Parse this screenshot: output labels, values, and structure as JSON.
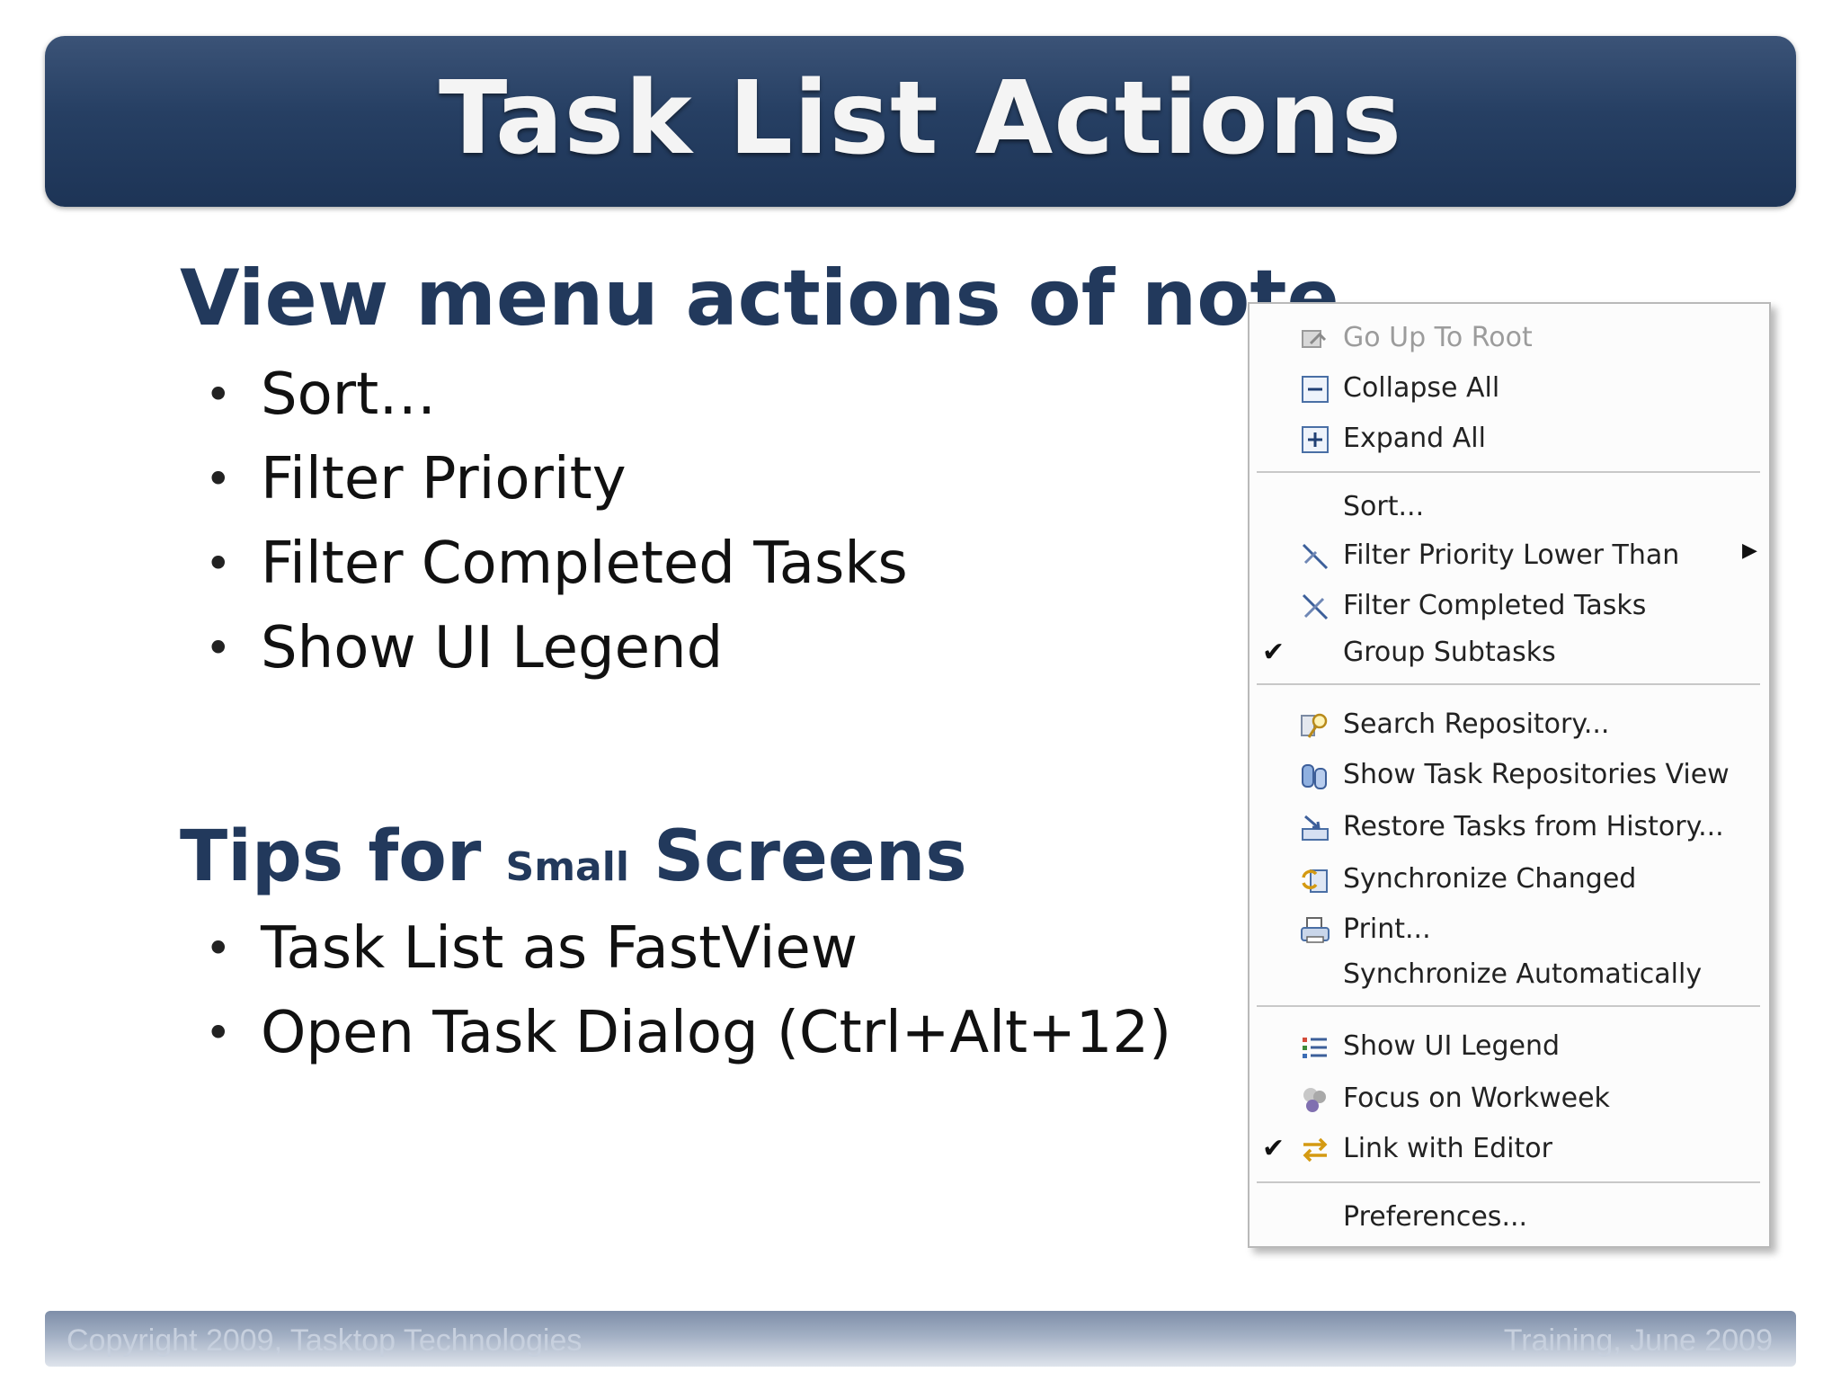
{
  "slide": {
    "title": "Task List Actions",
    "section1": {
      "heading": "View menu actions of note",
      "bullets": [
        "Sort…",
        "Filter Priority",
        "Filter Completed Tasks",
        "Show UI Legend"
      ]
    },
    "section2": {
      "heading_part1": "Tips for ",
      "heading_small": "Small",
      "heading_part2": " Screens",
      "bullets": [
        "Task List as FastView",
        "Open Task Dialog (Ctrl+Alt+12)"
      ]
    },
    "footer": {
      "left": "Copyright 2009, Tasktop Technologies",
      "right": "Training, June 2009"
    }
  },
  "menu": {
    "items": [
      {
        "label": "Go Up To Root",
        "icon": "go-up-to-root-icon",
        "disabled": true
      },
      {
        "label": "Collapse All",
        "icon": "collapse-all-icon"
      },
      {
        "label": "Expand All",
        "icon": "expand-all-icon"
      },
      {
        "label": "Sort..."
      },
      {
        "label": "Filter Priority Lower Than",
        "icon": "filter-priority-icon",
        "submenu": true
      },
      {
        "label": "Filter Completed Tasks",
        "icon": "filter-completed-icon"
      },
      {
        "label": "Group Subtasks",
        "checked": true
      },
      {
        "label": "Search Repository...",
        "icon": "search-repository-icon"
      },
      {
        "label": "Show Task Repositories View",
        "icon": "task-repositories-icon"
      },
      {
        "label": "Restore Tasks from History...",
        "icon": "restore-history-icon"
      },
      {
        "label": "Synchronize Changed",
        "icon": "synchronize-icon"
      },
      {
        "label": "Print...",
        "icon": "print-icon"
      },
      {
        "label": "Synchronize Automatically"
      },
      {
        "label": "Show UI Legend",
        "icon": "ui-legend-icon"
      },
      {
        "label": "Focus on Workweek",
        "icon": "focus-workweek-icon"
      },
      {
        "label": "Link with Editor",
        "icon": "link-editor-icon",
        "checked": true
      },
      {
        "label": "Preferences..."
      }
    ],
    "check_glyph": "✔",
    "submenu_glyph": "▶"
  }
}
